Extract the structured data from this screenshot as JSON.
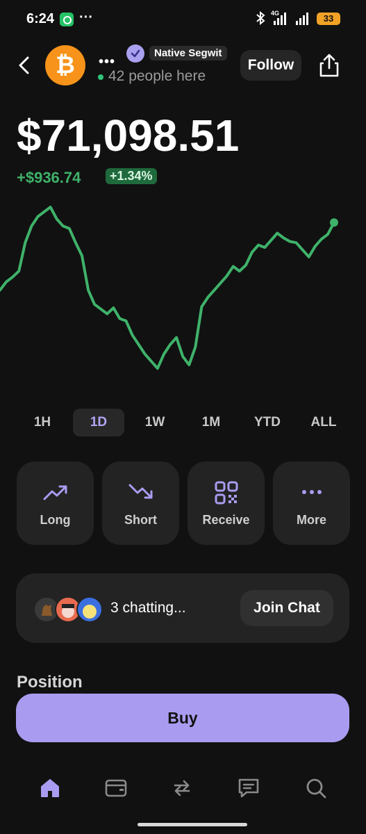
{
  "status_bar": {
    "time": "6:24",
    "dots": "···",
    "network": "4G",
    "battery": "33"
  },
  "header": {
    "coin_symbol": "₿",
    "more": "•••",
    "tag": "Native Segwit",
    "people_here": "42 people here",
    "follow_label": "Follow"
  },
  "price": {
    "value": "$71,098.51",
    "change": "+$936.74",
    "change_pct": "+1.34%"
  },
  "colors": {
    "accent": "#a99cf0",
    "positive": "#3fb26a",
    "background": "#111111",
    "card": "#232323"
  },
  "chart_data": {
    "type": "line",
    "title": "",
    "xlabel": "",
    "ylabel": "",
    "grid": false,
    "note_range": "1D",
    "series": [
      {
        "values": [
          70020,
          70090,
          70130,
          70180,
          70420,
          70560,
          70640,
          70680,
          70720,
          70620,
          70560,
          70540,
          70420,
          70310,
          70020,
          69900,
          69860,
          69820,
          69870,
          69780,
          69760,
          69640,
          69560,
          69480,
          69420,
          69360,
          69480,
          69560,
          69620,
          69460,
          69390,
          69540,
          69880,
          69960,
          70020,
          70080,
          70140,
          70220,
          70180,
          70230,
          70340,
          70400,
          70380,
          70440,
          70500,
          70460,
          70430,
          70420,
          70360,
          70300,
          70390,
          70450,
          70490,
          70590
        ]
      }
    ]
  },
  "ranges": [
    "1H",
    "1D",
    "1W",
    "1M",
    "YTD",
    "ALL"
  ],
  "active_range": "1D",
  "actions": [
    {
      "label": "Long",
      "icon": "trend-up-icon"
    },
    {
      "label": "Short",
      "icon": "trend-down-icon"
    },
    {
      "label": "Receive",
      "icon": "qr-code-icon"
    },
    {
      "label": "More",
      "icon": "more-dots-icon"
    }
  ],
  "chat": {
    "chatting_text": "3 chatting...",
    "join_label": "Join Chat"
  },
  "position_label": "Position",
  "buy_label": "Buy",
  "bottom_nav": [
    {
      "icon": "home-icon"
    },
    {
      "icon": "wallet-icon"
    },
    {
      "icon": "swap-icon"
    },
    {
      "icon": "chat-icon"
    },
    {
      "icon": "search-icon"
    }
  ]
}
